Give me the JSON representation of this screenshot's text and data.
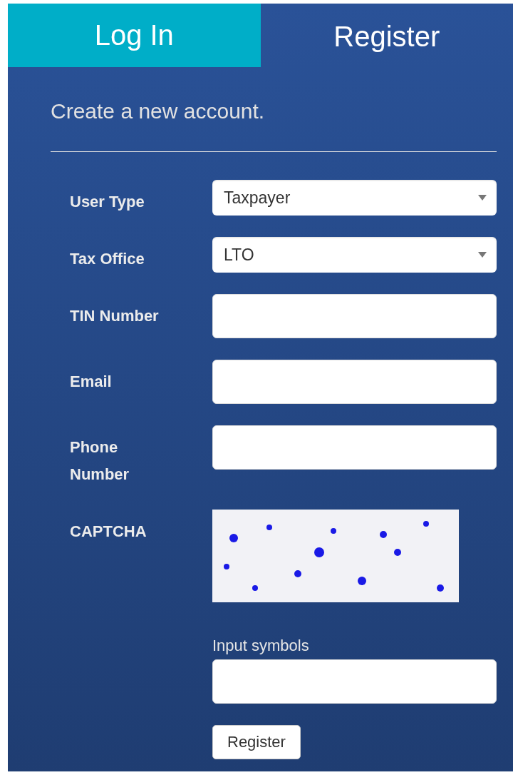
{
  "tabs": [
    {
      "label": "Log In",
      "selected": false
    },
    {
      "label": "Register",
      "selected": true
    }
  ],
  "heading": "Create a new account.",
  "fields": [
    {
      "kind": "select",
      "label": "User Type",
      "value": "Taxpayer"
    },
    {
      "kind": "select",
      "label": "Tax Office",
      "value": "LTO"
    },
    {
      "kind": "text",
      "label": "TIN Number"
    },
    {
      "kind": "text",
      "label": "Email"
    },
    {
      "kind": "text",
      "label": "Phone Number"
    },
    {
      "kind": "captcha",
      "label": "CAPTCHA",
      "input_label": "Input symbols"
    }
  ],
  "submit": "Register"
}
